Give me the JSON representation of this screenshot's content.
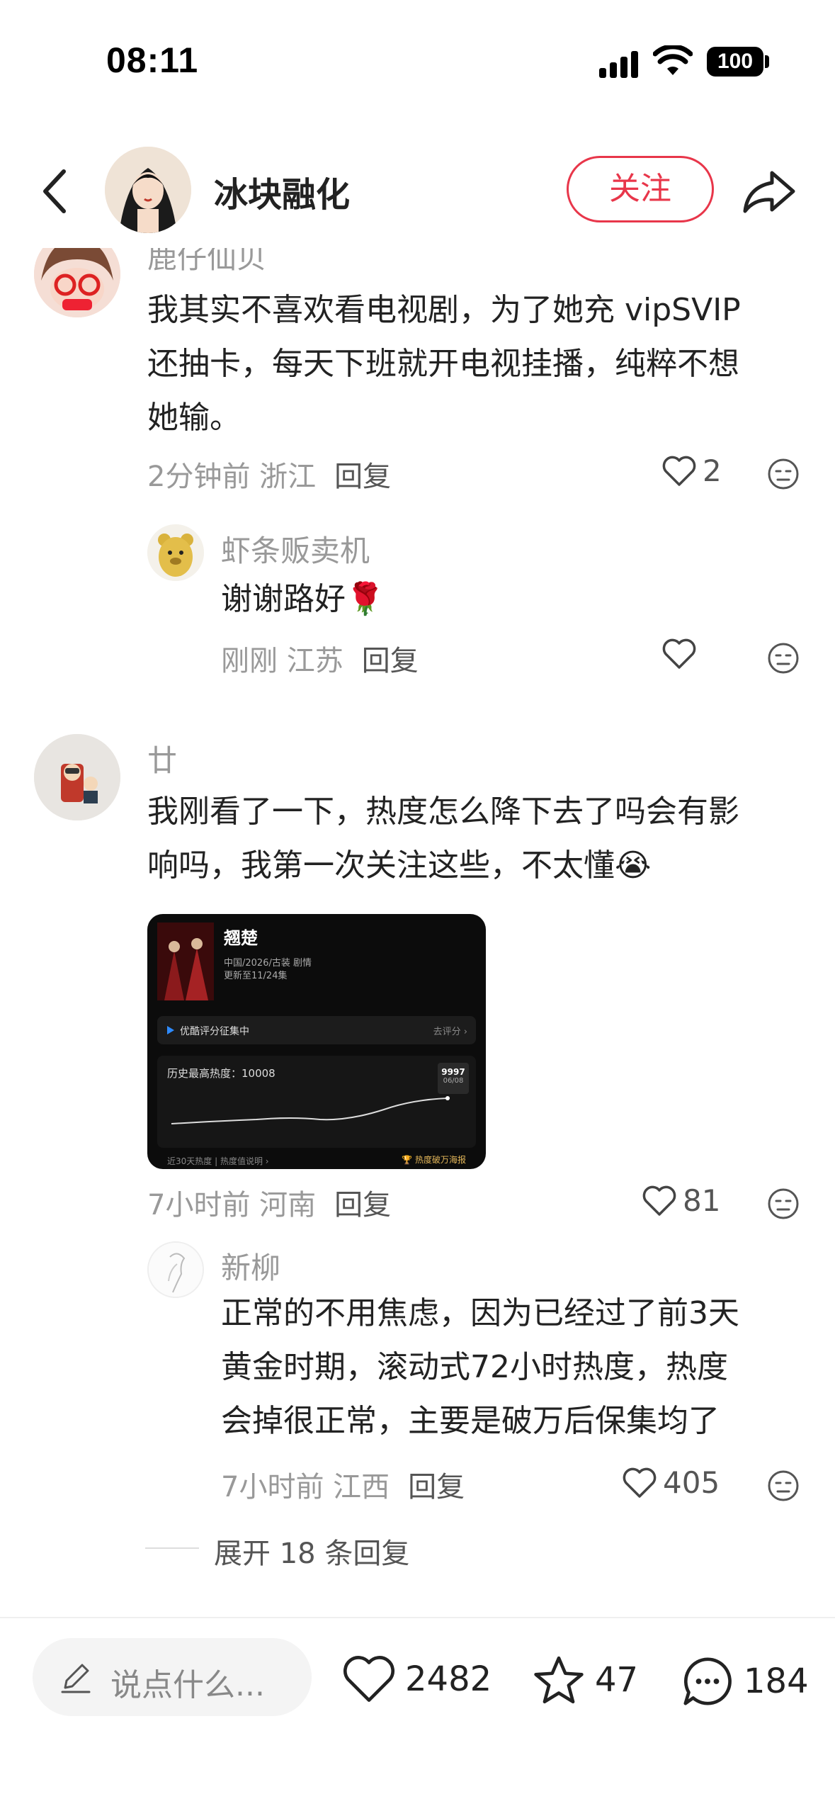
{
  "status": {
    "time": "08:11",
    "battery": "100"
  },
  "header": {
    "author": "冰块融化",
    "follow_label": "关注"
  },
  "comments": [
    {
      "user": "鹿仔仙贝",
      "text": [
        "我其实不喜欢看电视剧，为了她充 vipSVIP",
        "还抽卡，每天下班就开电视挂播，纯粹不想",
        "她输。"
      ],
      "time_loc": "2分钟前 浙江",
      "reply_label": "回复",
      "likes": "2",
      "replies": [
        {
          "user": "虾条贩卖机",
          "text": "谢谢路好🌹",
          "time_loc": "刚刚 江苏",
          "reply_label": "回复",
          "likes": ""
        }
      ]
    },
    {
      "user": "廿",
      "text": [
        "我刚看了一下，热度怎么降下去了吗会有影",
        "响吗，我第一次关注这些，不太懂😭"
      ],
      "time_loc": "7小时前 河南",
      "reply_label": "回复",
      "likes": "81",
      "image": {
        "title": "翘楚",
        "sub1": "中国/2026/古装 剧情",
        "sub2": "更新至11/24集",
        "rating_label": "优酷评分征集中",
        "rating_action": "去评分 ›",
        "heat_label": "历史最高热度：10008",
        "heat_value": "9997",
        "heat_date": "06/08",
        "footer_left": "近30天热度 | 热度值说明 ›",
        "footer_right": "热度破万海报"
      },
      "replies": [
        {
          "user": "新柳",
          "text": [
            "正常的不用焦虑，因为已经过了前3天",
            "黄金时期，滚动式72小时热度，热度",
            "会掉很正常，主要是破万后保集均了"
          ],
          "time_loc": "7小时前 江西",
          "reply_label": "回复",
          "likes": "405"
        }
      ],
      "expand_label": "展开 18 条回复"
    }
  ],
  "bottom": {
    "placeholder": "说点什么...",
    "likes": "2482",
    "stars": "47",
    "comments": "184"
  },
  "colors": {
    "accent": "#e8364a",
    "muted": "#999999",
    "text": "#222222"
  }
}
